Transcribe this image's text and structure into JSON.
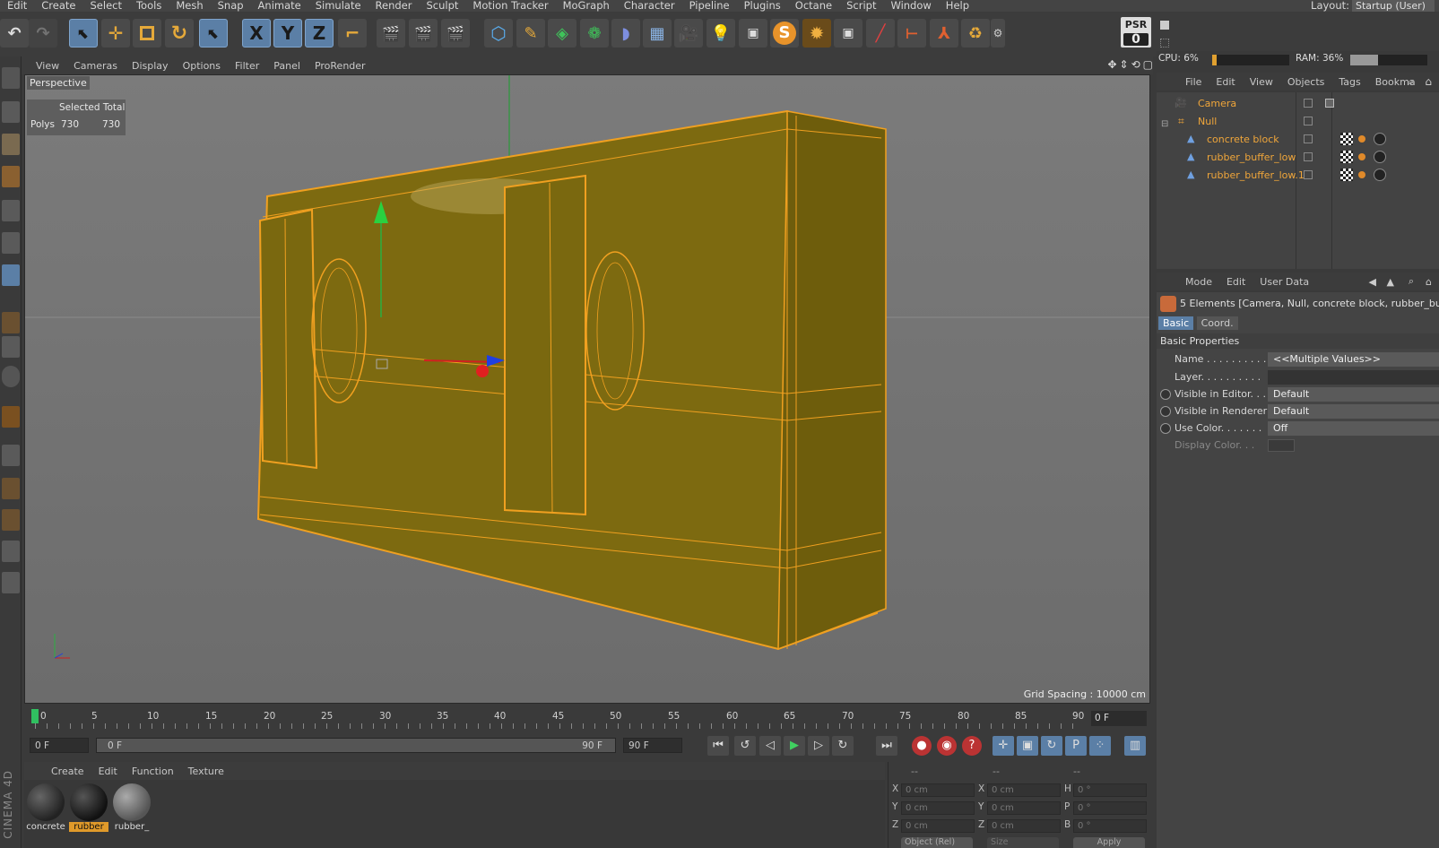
{
  "menubar": {
    "items": [
      "Edit",
      "Create",
      "Select",
      "Tools",
      "Mesh",
      "Snap",
      "Animate",
      "Simulate",
      "Render",
      "Sculpt",
      "Motion Tracker",
      "MoGraph",
      "Character",
      "Pipeline",
      "Plugins",
      "Octane",
      "Script",
      "Window",
      "Help"
    ],
    "layout_label": "Layout:",
    "layout_value": "Startup (User)"
  },
  "toolbar": {
    "psr_label": "PSR",
    "psr_value": "0",
    "axis_x": "X",
    "axis_y": "Y",
    "axis_z": "Z",
    "octane_label": "S"
  },
  "viewport": {
    "menu": [
      "View",
      "Cameras",
      "Display",
      "Options",
      "Filter",
      "Panel",
      "ProRender"
    ],
    "camera_label": "Perspective",
    "stats": {
      "header": "Selected Total",
      "row_label": "Polys",
      "selected": "730",
      "total": "730"
    },
    "grid_spacing": "Grid Spacing : 10000 cm"
  },
  "timeline": {
    "ticks": [
      "0",
      "5",
      "10",
      "15",
      "20",
      "25",
      "30",
      "35",
      "40",
      "45",
      "50",
      "55",
      "60",
      "65",
      "70",
      "75",
      "80",
      "85",
      "90"
    ],
    "current_frame": "0 F"
  },
  "transport": {
    "start": "0 F",
    "range_start": "0 F",
    "range_end": "90 F",
    "end": "90 F"
  },
  "materials": {
    "menu": [
      "Create",
      "Edit",
      "Function",
      "Texture"
    ],
    "items": [
      {
        "label": "concrete",
        "color": "#2b2b2b",
        "selected": false
      },
      {
        "label": "rubber",
        "color": "#1e1e1e",
        "selected": true
      },
      {
        "label": "rubber_",
        "color": "#7a7a7a",
        "selected": false
      }
    ]
  },
  "coordinates": {
    "header": [
      "--",
      "--",
      "--"
    ],
    "rows": [
      {
        "a": "X",
        "av": "0 cm",
        "b": "X",
        "bv": "0 cm",
        "c": "H",
        "cv": "0 °"
      },
      {
        "a": "Y",
        "av": "0 cm",
        "b": "Y",
        "bv": "0 cm",
        "c": "P",
        "cv": "0 °"
      },
      {
        "a": "Z",
        "av": "0 cm",
        "b": "Z",
        "bv": "0 cm",
        "c": "B",
        "cv": "0 °"
      }
    ],
    "mode_select": "Object (Rel)",
    "size_select": "Size",
    "apply": "Apply"
  },
  "status": {
    "cpu": "CPU: 6%",
    "ram": "RAM: 36%",
    "cpu_fraction": 0.06,
    "ram_fraction": 0.36
  },
  "objects": {
    "menu": [
      "File",
      "Edit",
      "View",
      "Objects",
      "Tags",
      "Bookma"
    ],
    "items": [
      {
        "name": "Camera",
        "depth": 0
      },
      {
        "name": "Null",
        "depth": 0
      },
      {
        "name": "concrete block",
        "depth": 1
      },
      {
        "name": "rubber_buffer_low",
        "depth": 1
      },
      {
        "name": "rubber_buffer_low.1",
        "depth": 1
      }
    ]
  },
  "attributes": {
    "menu": [
      "Mode",
      "Edit",
      "User Data"
    ],
    "selection_desc": "5 Elements [Camera, Null, concrete block, rubber_buffer_",
    "tabs": [
      "Basic",
      "Coord."
    ],
    "section_title": "Basic Properties",
    "rows": [
      {
        "label": "Name . . . . . . . . . .",
        "value": "<<Multiple Values>>"
      },
      {
        "label": "Layer. . . . . . . . . .",
        "value": ""
      },
      {
        "label": "Visible in Editor. . .",
        "value": "Default"
      },
      {
        "label": "Visible in Renderer",
        "value": "Default"
      },
      {
        "label": "Use Color. . . . . . .",
        "value": "Off"
      },
      {
        "label": "Display Color. . .",
        "value": ""
      }
    ]
  },
  "brand": "CINEMA 4D"
}
